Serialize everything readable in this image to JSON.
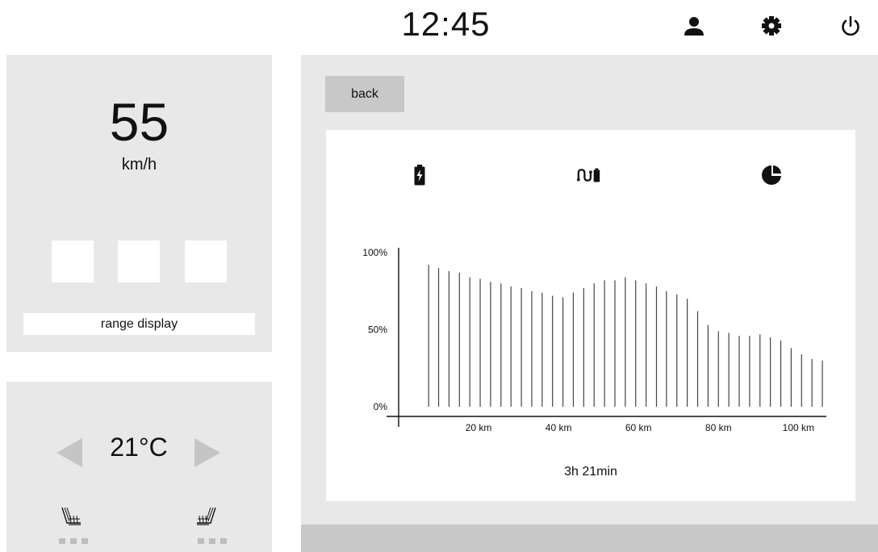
{
  "header": {
    "time": "12:45",
    "icons": [
      "user-icon",
      "settings-gear-icon",
      "power-icon"
    ]
  },
  "speed": {
    "value": "55",
    "unit": "km/h",
    "range_display_label": "range display"
  },
  "climate": {
    "temperature": "21°C",
    "seat_heating_left_levels": 3,
    "seat_heating_right_levels": 3
  },
  "main": {
    "back_label": "back",
    "tab_icons": [
      "battery-charging-icon",
      "route-battery-icon",
      "pie-chart-icon"
    ],
    "duration": "3h 21min"
  },
  "chart_data": {
    "type": "bar",
    "title": "",
    "xlabel": "",
    "ylabel": "",
    "y_ticks": [
      "0%",
      "50%",
      "100%"
    ],
    "x_ticks": [
      "20 km",
      "40 km",
      "60 km",
      "80 km",
      "100 km"
    ],
    "x_tick_values": [
      20,
      40,
      60,
      80,
      100
    ],
    "xlim": [
      0,
      107
    ],
    "ylim": [
      0,
      100
    ],
    "x": [
      7.5,
      10,
      12.6,
      15.2,
      17.8,
      20.4,
      23,
      25.6,
      28.1,
      30.7,
      33.3,
      35.9,
      38.5,
      41.1,
      43.7,
      46.3,
      48.9,
      51.5,
      54.1,
      56.7,
      59.3,
      61.9,
      64.5,
      67,
      69.6,
      72.2,
      74.8,
      77.4,
      80,
      82.6,
      85.2,
      87.8,
      90.4,
      93,
      95.6,
      98.2,
      100.8,
      103.4,
      106
    ],
    "values": [
      92,
      90,
      88,
      87,
      84,
      83,
      81,
      80,
      78,
      77,
      75,
      74,
      72,
      71,
      74,
      77,
      80,
      82,
      82,
      84,
      82,
      80,
      78,
      75,
      73,
      70,
      62,
      53,
      49,
      48,
      46,
      46,
      47,
      45,
      43,
      38,
      34,
      31,
      30
    ]
  }
}
